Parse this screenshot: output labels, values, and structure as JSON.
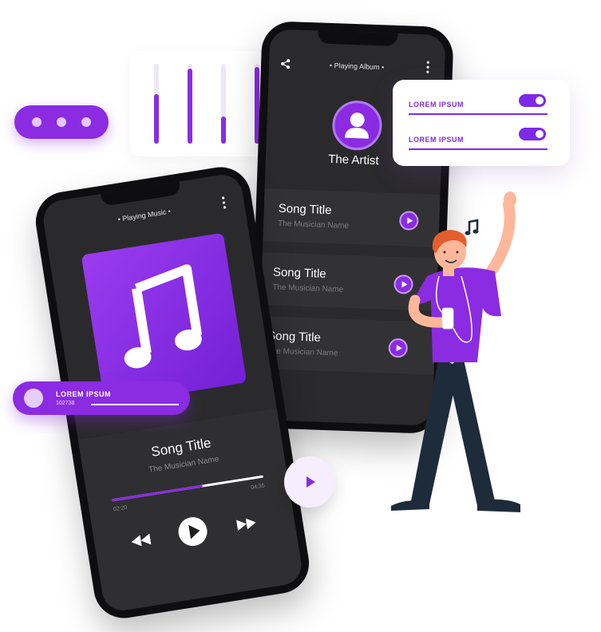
{
  "colors": {
    "accent": "#8b2be2",
    "phone": "#0e0e10",
    "screen": "#2a2a2c"
  },
  "equalizer": {
    "levels": [
      0.62,
      0.94,
      0.34,
      0.96
    ]
  },
  "menu_pill": {
    "dots": 3
  },
  "album_phone": {
    "header": "• Playing Album •",
    "artist": "The Artist",
    "songs": [
      {
        "title": "Song Title",
        "artist": "The Musician Name"
      },
      {
        "title": "Song Title",
        "artist": "The Musician Name"
      },
      {
        "title": "Song Title",
        "artist": "The Musician Name"
      }
    ]
  },
  "settings_card": {
    "items": [
      {
        "label": "LOREM IPSUM",
        "on": true
      },
      {
        "label": "LOREM IPSUM",
        "on": true
      }
    ]
  },
  "music_phone": {
    "header": "• Playing Music •",
    "song_title": "Song Title",
    "song_artist": "The Musician Name",
    "time_elapsed": "02:20",
    "time_total": "04:35",
    "progress": 0.6
  },
  "user_chip": {
    "label": "LOREM IPSUM",
    "number": "102738"
  },
  "icons": {
    "share": "share-icon",
    "kebab": "more-vertical-icon",
    "music_note": "music-note-icon",
    "play": "play-icon",
    "rewind": "rewind-icon",
    "forward": "fast-forward-icon",
    "person": "person-icon"
  }
}
